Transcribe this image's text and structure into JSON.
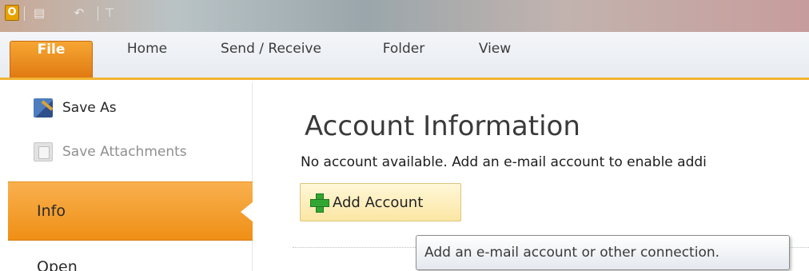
{
  "qat": {
    "app_icon_letter": "O",
    "icons": [
      "outlook-logo-icon",
      "send-receive-icon",
      "undo-icon",
      "customize-qat-icon"
    ]
  },
  "tabs": [
    {
      "label": "File",
      "active": true
    },
    {
      "label": "Home"
    },
    {
      "label": "Send / Receive"
    },
    {
      "label": "Folder"
    },
    {
      "label": "View"
    }
  ],
  "backstage_nav": {
    "save_as": "Save As",
    "save_attachments": "Save Attachments",
    "info": "Info",
    "open": "Open"
  },
  "main": {
    "title": "Account Information",
    "description": "No account available. Add an e-mail account to enable addi",
    "add_account_label": "Add Account",
    "tooltip": "Add an e-mail account or other connection."
  },
  "colors": {
    "file_tab": "#e88a1f",
    "info_highlight": "#f4a233",
    "ribbon_accent": "#f2b433",
    "add_button_bg": "#fcebb0",
    "plus_icon": "#33a533"
  }
}
